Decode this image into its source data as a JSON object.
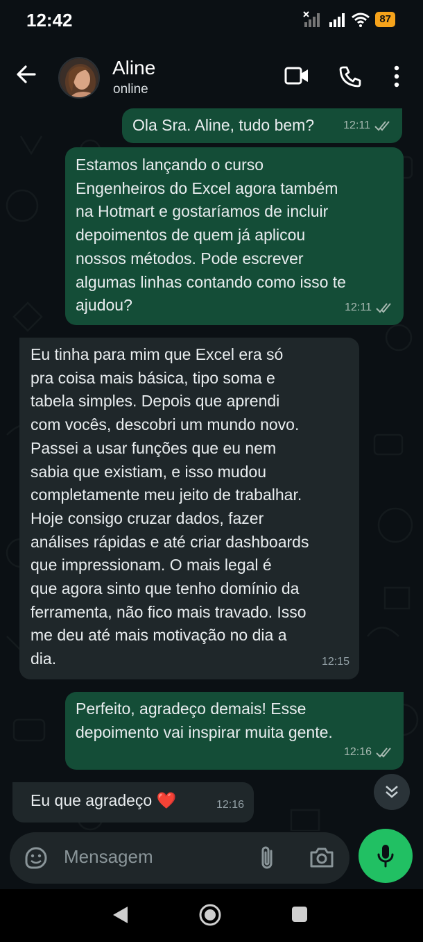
{
  "status_bar": {
    "time": "12:42",
    "battery": "87"
  },
  "header": {
    "contact_name": "Aline",
    "contact_status": "online"
  },
  "messages": [
    {
      "text": "Ola Sra. Aline, tudo bem?",
      "time": "12:11"
    },
    {
      "text": "Estamos lançando o curso\nEngenheiros do Excel agora também\nna Hotmart e gostaríamos de incluir\ndepoimentos de quem já aplicou\nnossos métodos. Pode escrever\nalgumas linhas contando como isso te\najudou?",
      "time": "12:11"
    },
    {
      "text": "Eu tinha para mim que Excel era só\npra coisa mais básica, tipo soma e\ntabela simples. Depois que aprendi\ncom vocês, descobri um mundo novo.\nPassei a usar funções que eu nem\nsabia que existiam, e isso mudou\ncompletamente meu jeito de trabalhar.\nHoje consigo cruzar dados, fazer\nanálises rápidas e até criar dashboards\nque impressionam. O mais legal é\nque agora sinto que tenho domínio da\nferramenta, não fico mais travado. Isso\nme deu até mais motivação no dia a\ndia.",
      "time": "12:15"
    },
    {
      "text": "Perfeito, agradeço demais! Esse\ndepoimento vai inspirar muita gente.",
      "time": "12:16"
    },
    {
      "text": "Eu que agradeço ❤️",
      "time": "12:16"
    }
  ],
  "composer": {
    "placeholder": "Mensagem"
  },
  "colors": {
    "outgoing_bubble": "#144d37",
    "incoming_bubble": "#1f272a",
    "mic_button": "#21c063",
    "battery": "#f6a31b"
  }
}
